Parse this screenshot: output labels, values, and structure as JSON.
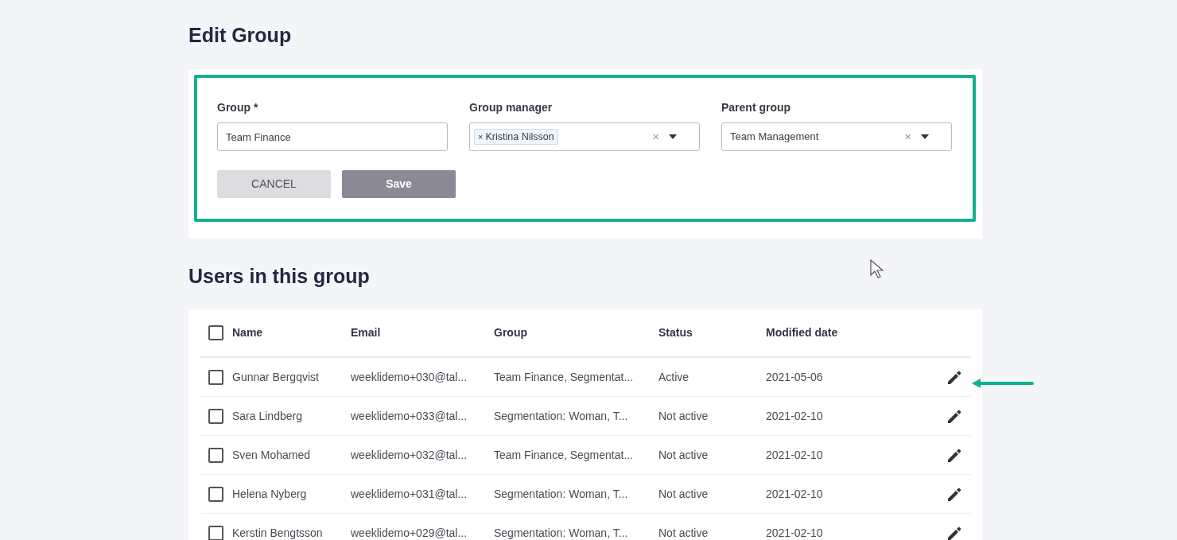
{
  "title": "Edit Group",
  "form": {
    "fields": [
      {
        "kind": "text",
        "label": "Group *",
        "value": "Team Finance"
      },
      {
        "kind": "multiselect",
        "label": "Group manager",
        "chips": [
          {
            "remove": "×",
            "label": "Kristina Nilsson"
          }
        ],
        "clear": "×"
      },
      {
        "kind": "select",
        "label": "Parent group",
        "value": "Team Management",
        "clear": "×"
      }
    ],
    "buttons": [
      {
        "kind": "secondary",
        "label": "CANCEL"
      },
      {
        "kind": "primary",
        "label": "Save"
      }
    ]
  },
  "users": {
    "title": "Users in this group",
    "header_checked": false,
    "columns": [
      "Name",
      "Email",
      "Group",
      "Status",
      "Modified date"
    ],
    "rows": [
      {
        "checked": false,
        "cells": [
          "Gunnar Bergqvist",
          "weeklidemo+030@tal...",
          "Team Finance, Segmentat...",
          "Active",
          "2021-05-06"
        ]
      },
      {
        "checked": false,
        "cells": [
          "Sara Lindberg",
          "weeklidemo+033@tal...",
          "Segmentation: Woman, T...",
          "Not active",
          "2021-02-10"
        ]
      },
      {
        "checked": false,
        "cells": [
          "Sven Mohamed",
          "weeklidemo+032@tal...",
          "Team Finance, Segmentat...",
          "Not active",
          "2021-02-10"
        ]
      },
      {
        "checked": false,
        "cells": [
          "Helena Nyberg",
          "weeklidemo+031@tal...",
          "Segmentation: Woman, T...",
          "Not active",
          "2021-02-10"
        ]
      },
      {
        "checked": false,
        "cells": [
          "Kerstin Bengtsson",
          "weeklidemo+029@tal...",
          "Segmentation: Woman, T...",
          "Not active",
          "2021-02-10"
        ]
      }
    ]
  }
}
